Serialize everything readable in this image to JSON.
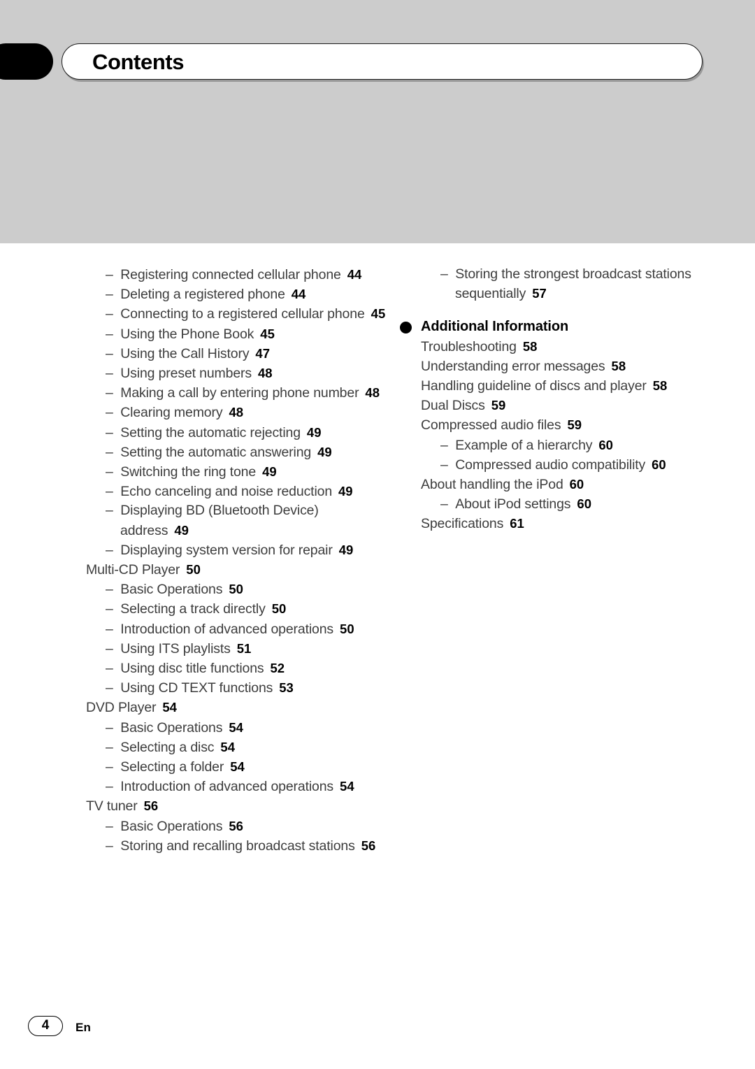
{
  "header": {
    "title": "Contents",
    "tab_icon": "black-tab-marker"
  },
  "footer": {
    "page_number": "4",
    "language_code": "En"
  },
  "columns": {
    "left": [
      {
        "level": 2,
        "text": "Registering connected cellular phone",
        "page": "44"
      },
      {
        "level": 2,
        "text": "Deleting a registered phone",
        "page": "44"
      },
      {
        "level": 2,
        "text": "Connecting to a registered cellular phone",
        "page": "45"
      },
      {
        "level": 2,
        "text": "Using the Phone Book",
        "page": "45"
      },
      {
        "level": 2,
        "text": "Using the Call History",
        "page": "47"
      },
      {
        "level": 2,
        "text": "Using preset numbers",
        "page": "48"
      },
      {
        "level": 2,
        "text": "Making a call by entering phone number",
        "page": "48"
      },
      {
        "level": 2,
        "text": "Clearing memory",
        "page": "48"
      },
      {
        "level": 2,
        "text": "Setting the automatic rejecting",
        "page": "49"
      },
      {
        "level": 2,
        "text": "Setting the automatic answering",
        "page": "49"
      },
      {
        "level": 2,
        "text": "Switching the ring tone",
        "page": "49"
      },
      {
        "level": 2,
        "text": "Echo canceling and noise reduction",
        "page": "49"
      },
      {
        "level": 2,
        "text": "Displaying BD (Bluetooth Device) address",
        "page": "49"
      },
      {
        "level": 2,
        "text": "Displaying system version for repair",
        "page": "49"
      },
      {
        "level": 1,
        "text": "Multi-CD Player",
        "page": "50"
      },
      {
        "level": 2,
        "text": "Basic Operations",
        "page": "50"
      },
      {
        "level": 2,
        "text": "Selecting a track directly",
        "page": "50"
      },
      {
        "level": 2,
        "text": "Introduction of advanced operations",
        "page": "50"
      },
      {
        "level": 2,
        "text": "Using ITS playlists",
        "page": "51"
      },
      {
        "level": 2,
        "text": "Using disc title functions",
        "page": "52"
      },
      {
        "level": 2,
        "text": "Using CD TEXT functions",
        "page": "53"
      },
      {
        "level": 1,
        "text": "DVD Player",
        "page": "54"
      },
      {
        "level": 2,
        "text": "Basic Operations",
        "page": "54"
      },
      {
        "level": 2,
        "text": "Selecting a disc",
        "page": "54"
      },
      {
        "level": 2,
        "text": "Selecting a folder",
        "page": "54"
      },
      {
        "level": 2,
        "text": "Introduction of advanced operations",
        "page": "54"
      },
      {
        "level": 1,
        "text": "TV tuner",
        "page": "56"
      },
      {
        "level": 2,
        "text": "Basic Operations",
        "page": "56"
      },
      {
        "level": 2,
        "text": "Storing and recalling broadcast stations",
        "page": "56"
      }
    ],
    "right_top": [
      {
        "level": 2,
        "text": "Storing the strongest broadcast stations sequentially",
        "page": "57"
      }
    ],
    "right_section": {
      "heading": "Additional Information",
      "bullet_icon": "filled-circle-bullet",
      "items": [
        {
          "level": 1,
          "text": "Troubleshooting",
          "page": "58"
        },
        {
          "level": 1,
          "text": "Understanding error messages",
          "page": "58"
        },
        {
          "level": 1,
          "text": "Handling guideline of discs and player",
          "page": "58"
        },
        {
          "level": 1,
          "text": "Dual Discs",
          "page": "59"
        },
        {
          "level": 1,
          "text": "Compressed audio files",
          "page": "59"
        },
        {
          "level": 2,
          "text": "Example of a hierarchy",
          "page": "60"
        },
        {
          "level": 2,
          "text": "Compressed audio compatibility",
          "page": "60"
        },
        {
          "level": 1,
          "text": "About handling the iPod",
          "page": "60"
        },
        {
          "level": 2,
          "text": "About iPod settings",
          "page": "60"
        },
        {
          "level": 1,
          "text": "Specifications",
          "page": "61"
        }
      ]
    }
  },
  "colors": {
    "band": "#cccccc",
    "text": "#3d3d3d",
    "page_number": "#000000",
    "tab": "#000000"
  }
}
